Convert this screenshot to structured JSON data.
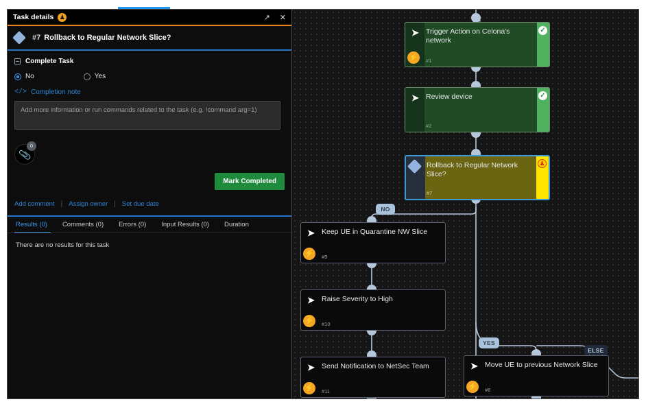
{
  "panel": {
    "header": {
      "title": "Task details",
      "owner_icon": "person-icon",
      "expand_icon": "expand-icon",
      "close_icon": "close-icon"
    },
    "task": {
      "number": "#7",
      "title": "Rollback to Regular Network Slice?",
      "type_icon": "diamond-icon"
    },
    "complete_task": {
      "section_label": "Complete Task",
      "options": [
        {
          "label": "No",
          "selected": true
        },
        {
          "label": "Yes",
          "selected": false
        }
      ],
      "note_label": "Completion note",
      "note_icon": "code-icon",
      "note_value": "",
      "note_placeholder": "Add more information or run commands related to the task (e.g. !command arg=1)",
      "attachment_icon": "paperclip-icon",
      "attachment_count": "0",
      "submit_label": "Mark Completed"
    },
    "quick_links": [
      {
        "label": "Add comment"
      },
      {
        "label": "Assign owner"
      },
      {
        "label": "Set due date"
      }
    ],
    "tabs": [
      {
        "label": "Results (0)",
        "active": true
      },
      {
        "label": "Comments (0)",
        "active": false
      },
      {
        "label": "Errors (0)",
        "active": false
      },
      {
        "label": "Input Results (0)",
        "active": false
      },
      {
        "label": "Duration",
        "active": false
      }
    ],
    "tab_content": "There are no results for this task"
  },
  "canvas": {
    "nodes": [
      {
        "id": "#1",
        "title": "Trigger Action on Celona's network",
        "icon": "chevron-right-icon",
        "has_bolt": true,
        "bolt_icon": "lightning-icon",
        "status": "complete",
        "status_icon": "check-circle-icon",
        "style": "green"
      },
      {
        "id": "#2",
        "title": "Review device",
        "icon": "chevron-right-icon",
        "has_bolt": false,
        "status": "complete",
        "status_icon": "check-circle-icon",
        "style": "green"
      },
      {
        "id": "#7",
        "title": "Rollback to Regular Network Slice?",
        "icon": "diamond-icon",
        "has_bolt": false,
        "status": "awaiting-owner",
        "status_icon": "person-alert-icon",
        "style": "selected"
      },
      {
        "id": "#9",
        "title": "Keep UE in Quarantine NW Slice",
        "icon": "chevron-right-icon",
        "has_bolt": true,
        "bolt_icon": "lightning-icon",
        "status": "none",
        "style": "dark"
      },
      {
        "id": "#10",
        "title": "Raise Severity to High",
        "icon": "chevron-right-icon",
        "has_bolt": true,
        "bolt_icon": "lightning-icon",
        "status": "none",
        "style": "dark"
      },
      {
        "id": "#11",
        "title": "Send Notification to NetSec Team",
        "icon": "chevron-right-icon",
        "has_bolt": true,
        "bolt_icon": "lightning-icon",
        "status": "none",
        "style": "dark"
      },
      {
        "id": "#8",
        "title": "Move UE to previous Network Slice",
        "icon": "chevron-right-icon",
        "has_bolt": true,
        "bolt_icon": "lightning-icon",
        "status": "none",
        "style": "dark"
      }
    ],
    "branch_labels": [
      {
        "label": "NO",
        "style": "light"
      },
      {
        "label": "YES",
        "style": "light"
      },
      {
        "label": "ELSE",
        "style": "dark"
      }
    ]
  },
  "colors": {
    "accent_blue": "#2276c9",
    "accent_orange": "#e8861b",
    "success_green": "#1e8a3c",
    "node_green": "#1f4a23",
    "node_selected": "#6b6410",
    "link_blue": "#2f86d8"
  }
}
